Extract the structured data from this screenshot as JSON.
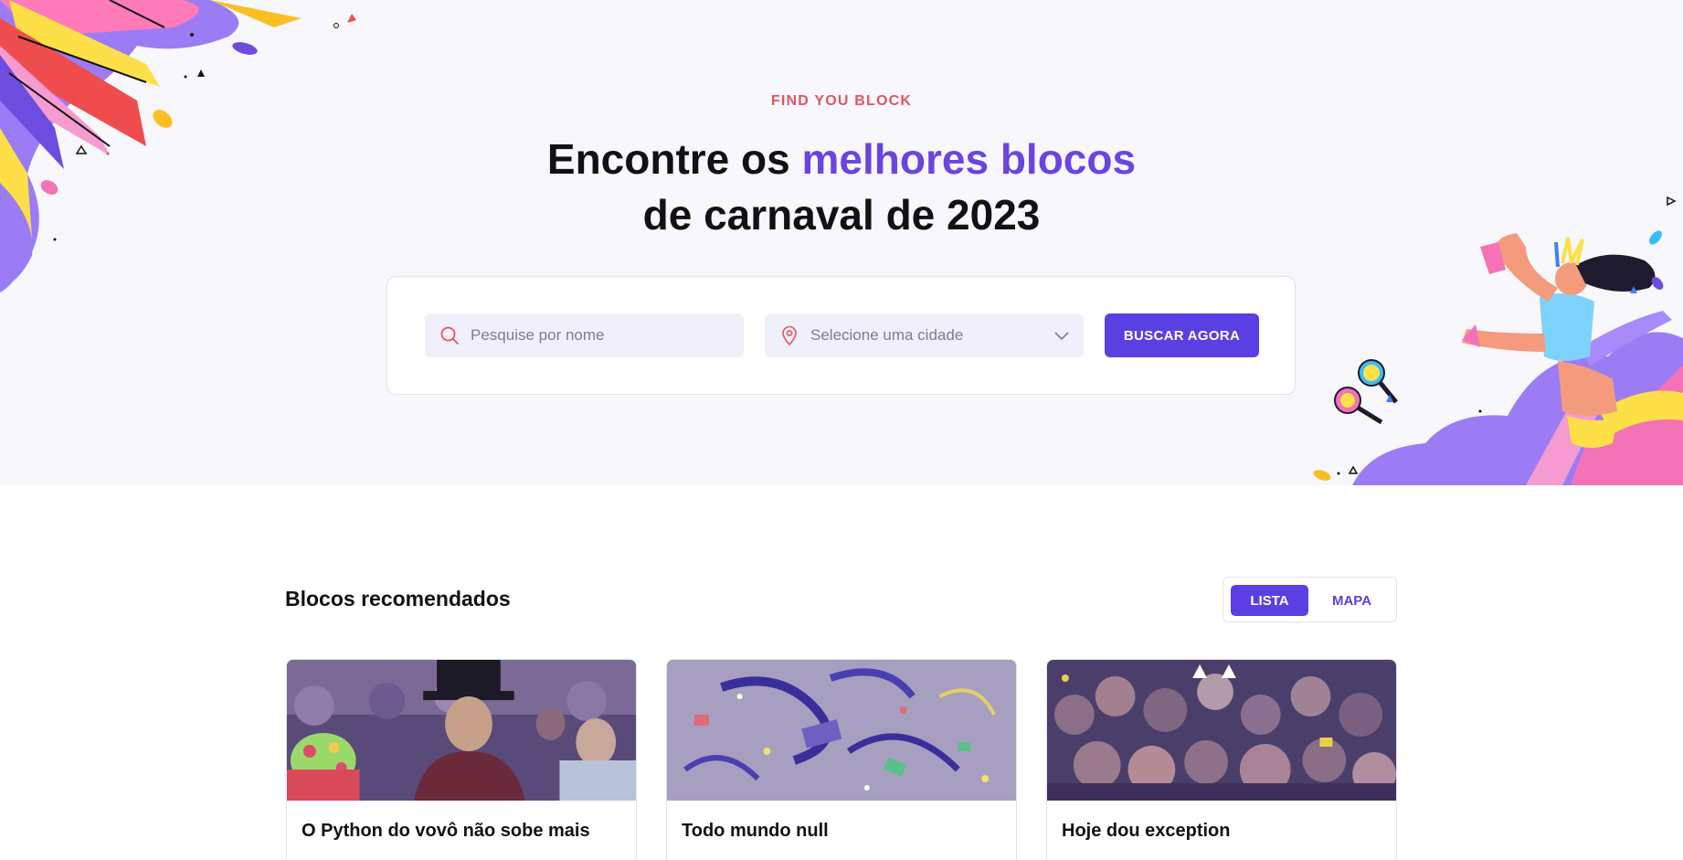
{
  "hero": {
    "eyebrow": "FIND YOU BLOCK",
    "headline_part1": "Encontre os ",
    "headline_accent": "melhores blocos",
    "headline_line2": "de carnaval de 2023"
  },
  "search": {
    "name_placeholder": "Pesquise por nome",
    "city_placeholder": "Selecione uma cidade",
    "submit_label": "BUSCAR AGORA"
  },
  "recommended": {
    "title": "Blocos recomendados",
    "view_toggle": {
      "list_label": "LISTA",
      "map_label": "MAPA",
      "selected": "LISTA"
    },
    "cards": [
      {
        "title": "O Python do vovô não sobe mais"
      },
      {
        "title": "Todo mundo null"
      },
      {
        "title": "Hoje dou exception"
      }
    ]
  },
  "icons": {
    "search": "search-icon",
    "location": "map-pin-icon",
    "dropdown": "chevron-down-icon"
  },
  "colors": {
    "brand": "#5b3fe3",
    "accent_text": "#6a45e0",
    "eyebrow": "#e0565f",
    "hero_bg": "#f7f7fc"
  }
}
